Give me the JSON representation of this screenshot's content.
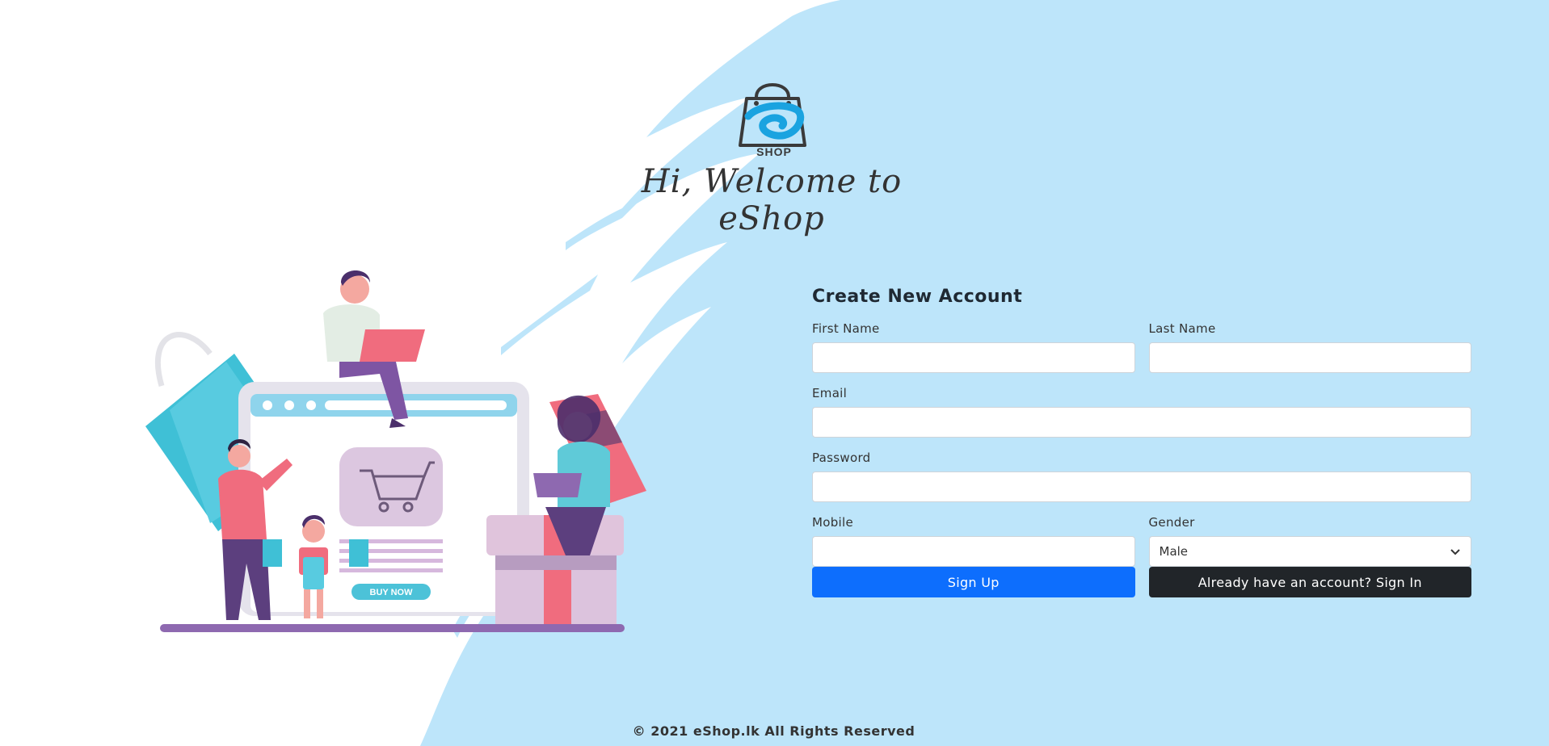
{
  "brand": {
    "logo_text": "SHOP",
    "welcome": "Hi, Welcome to eShop"
  },
  "illustration": {
    "button_label": "BUY NOW"
  },
  "form": {
    "title": "Create New Account",
    "first_name_label": "First Name",
    "first_name_value": "",
    "last_name_label": "Last Name",
    "last_name_value": "",
    "email_label": "Email",
    "email_value": "",
    "password_label": "Password",
    "password_value": "",
    "mobile_label": "Mobile",
    "mobile_value": "",
    "gender_label": "Gender",
    "gender_selected": "Male",
    "signup_label": "Sign Up",
    "signin_label": "Already have an account? Sign In"
  },
  "footer": {
    "text": "© 2021 eShop.lk All Rights Reserved"
  },
  "colors": {
    "background_stroke": "#bde5fa",
    "primary_button": "#0d6efd",
    "dark_button": "#212529",
    "logo_accent": "#1aa3e0"
  }
}
